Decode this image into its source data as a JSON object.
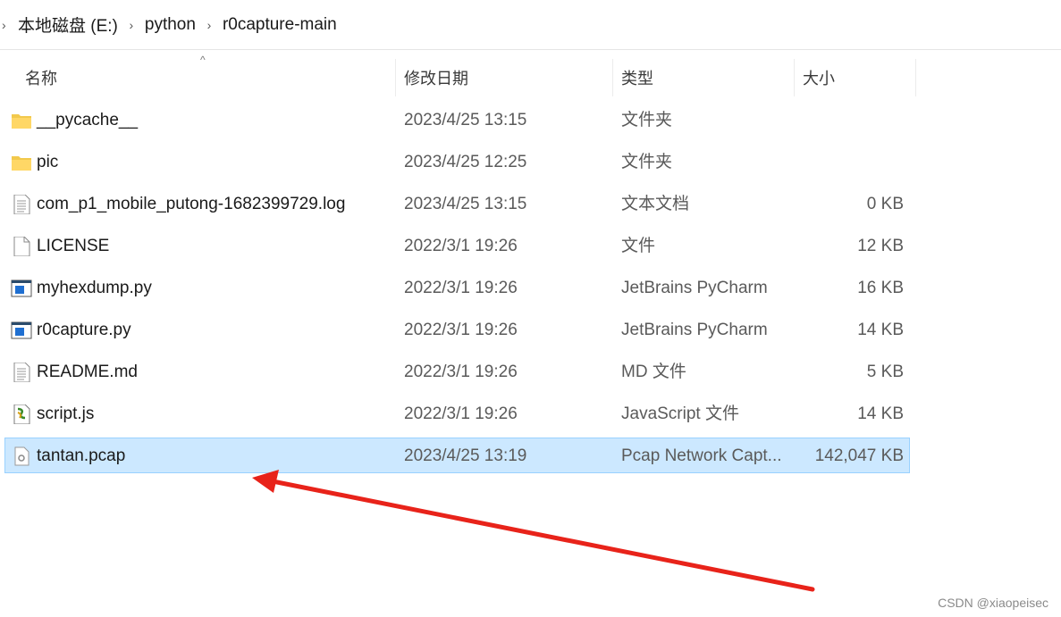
{
  "breadcrumb": {
    "items": [
      "本地磁盘 (E:)",
      "python",
      "r0capture-main"
    ]
  },
  "columns": {
    "name": "名称",
    "date": "修改日期",
    "type": "类型",
    "size": "大小"
  },
  "files": [
    {
      "name": "__pycache__",
      "date": "2023/4/25 13:15",
      "type": "文件夹",
      "size": "",
      "icon": "folder-icon"
    },
    {
      "name": "pic",
      "date": "2023/4/25 12:25",
      "type": "文件夹",
      "size": "",
      "icon": "folder-icon"
    },
    {
      "name": "com_p1_mobile_putong-1682399729.log",
      "date": "2023/4/25 13:15",
      "type": "文本文档",
      "size": "0 KB",
      "icon": "text-document-icon"
    },
    {
      "name": "LICENSE",
      "date": "2022/3/1 19:26",
      "type": "文件",
      "size": "12 KB",
      "icon": "blank-file-icon"
    },
    {
      "name": "myhexdump.py",
      "date": "2022/3/1 19:26",
      "type": "JetBrains PyCharm",
      "size": "16 KB",
      "icon": "pycharm-file-icon"
    },
    {
      "name": "r0capture.py",
      "date": "2022/3/1 19:26",
      "type": "JetBrains PyCharm",
      "size": "14 KB",
      "icon": "pycharm-file-icon"
    },
    {
      "name": "README.md",
      "date": "2022/3/1 19:26",
      "type": "MD 文件",
      "size": "5 KB",
      "icon": "text-document-icon"
    },
    {
      "name": "script.js",
      "date": "2022/3/1 19:26",
      "type": "JavaScript 文件",
      "size": "14 KB",
      "icon": "script-file-icon"
    },
    {
      "name": "tantan.pcap",
      "date": "2023/4/25 13:19",
      "type": "Pcap Network Capt...",
      "size": "142,047 KB",
      "icon": "pcap-file-icon",
      "selected": true
    }
  ],
  "colors": {
    "selection_bg": "#cce8ff",
    "selection_border": "#99d1ff",
    "annotation_arrow": "#e8231a"
  },
  "watermark": "CSDN @xiaopeisec"
}
